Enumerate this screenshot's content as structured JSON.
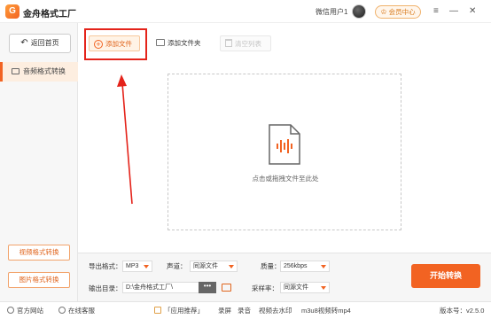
{
  "app": {
    "title": "金舟格式工厂",
    "logo_glyph": "G"
  },
  "header": {
    "username": "微信用户1",
    "vip_label": "会员中心",
    "vip_glyph": "♔",
    "menu_glyph": "≡",
    "minimize_glyph": "—",
    "close_glyph": "✕"
  },
  "sidebar": {
    "back_label": "返回首页",
    "back_glyph": "↶",
    "active_item": "音频格式转换",
    "video_btn": "视频格式转换",
    "image_btn": "图片格式转换"
  },
  "toolbar": {
    "add_file": "添加文件",
    "add_file_glyph": "+",
    "add_folder": "添加文件夹",
    "clear_list": "清空列表"
  },
  "dropzone": {
    "hint": "点击或拖拽文件至此处"
  },
  "settings": {
    "export_format_label": "导出格式：",
    "export_format_value": "MP3",
    "channel_label": "声道：",
    "channel_value": "同源文件",
    "quality_label": "质量：",
    "quality_value": "256kbps",
    "output_dir_label": "输出目录：",
    "output_dir_value": "D:\\金舟格式工厂\\",
    "more_glyph": "•••",
    "sample_rate_label": "采样率：",
    "sample_rate_value": "同源文件",
    "start_label": "开始转换"
  },
  "statusbar": {
    "website": "官方网站",
    "support": "在线客服",
    "recommend": "「应用推荐」",
    "record_screen": "录屏",
    "record_audio": "录音",
    "remove_watermark": "视频去水印",
    "m3u8": "m3u8视频转mp4",
    "version": "版本号：v2.5.0"
  },
  "colors": {
    "accent": "#f26322",
    "highlight_box": "#e4231a"
  }
}
